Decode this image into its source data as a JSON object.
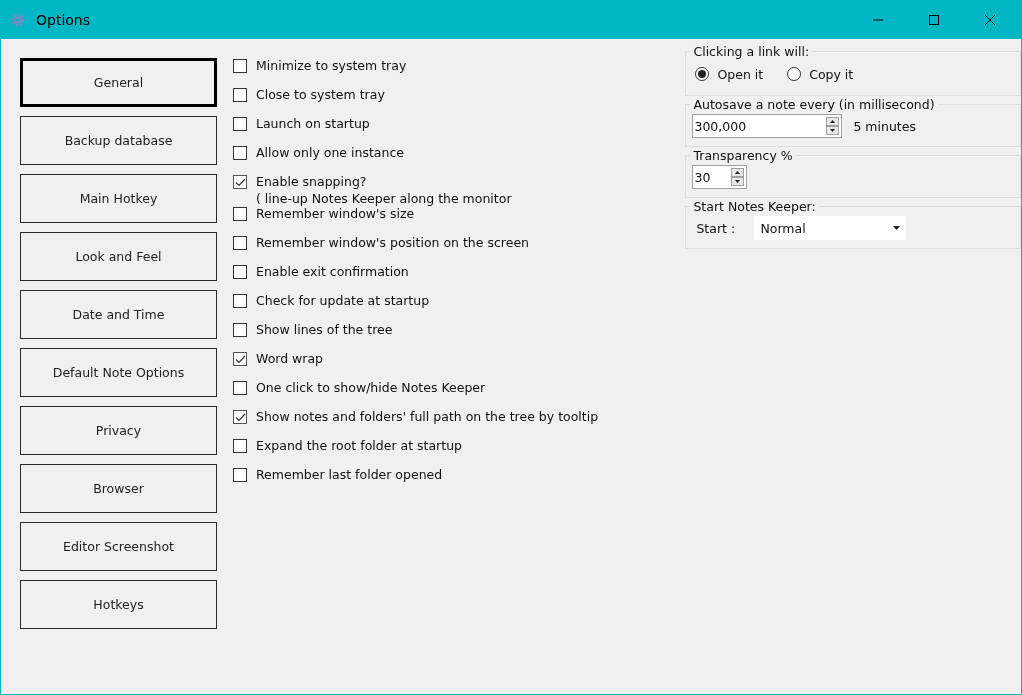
{
  "window": {
    "title": "Options"
  },
  "nav": [
    {
      "label": "General",
      "selected": true
    },
    {
      "label": "Backup database",
      "selected": false
    },
    {
      "label": "Main Hotkey",
      "selected": false
    },
    {
      "label": "Look and Feel",
      "selected": false
    },
    {
      "label": "Date and Time",
      "selected": false
    },
    {
      "label": "Default Note Options",
      "selected": false
    },
    {
      "label": "Privacy",
      "selected": false
    },
    {
      "label": "Browser",
      "selected": false
    },
    {
      "label": "Editor Screenshot",
      "selected": false
    },
    {
      "label": "Hotkeys",
      "selected": false
    }
  ],
  "options": [
    {
      "label": "Minimize to system tray",
      "checked": false
    },
    {
      "label": "Close to system tray",
      "checked": false
    },
    {
      "label": "Launch on startup",
      "checked": false
    },
    {
      "label": "Allow only one instance",
      "checked": false
    },
    {
      "label": "Enable snapping?\n( line-up Notes Keeper along the monitor",
      "checked": true
    },
    {
      "label": "Remember window's size",
      "checked": false
    },
    {
      "label": "Remember window's position on the screen",
      "checked": false
    },
    {
      "label": "Enable exit confirmation",
      "checked": false
    },
    {
      "label": "Check for update at startup",
      "checked": false
    },
    {
      "label": "Show lines of the tree",
      "checked": false
    },
    {
      "label": "Word wrap",
      "checked": true
    },
    {
      "label": "One click to show/hide Notes Keeper",
      "checked": false
    },
    {
      "label": "Show notes and folders' full path on the tree by tooltip",
      "checked": true
    },
    {
      "label": "Expand the root folder at startup",
      "checked": false
    },
    {
      "label": "Remember last folder opened",
      "checked": false
    }
  ],
  "link_group": {
    "title": "Clicking a link will:",
    "choices": [
      {
        "label": "Open it",
        "selected": true
      },
      {
        "label": "Copy it",
        "selected": false
      }
    ]
  },
  "autosave_group": {
    "title": "Autosave a note every (in millisecond)",
    "value": "300,000",
    "note": "5 minutes"
  },
  "transparency_group": {
    "title": "Transparency %",
    "value": "30"
  },
  "start_group": {
    "title": "Start Notes Keeper:",
    "label": "Start :",
    "value": "Normal"
  }
}
